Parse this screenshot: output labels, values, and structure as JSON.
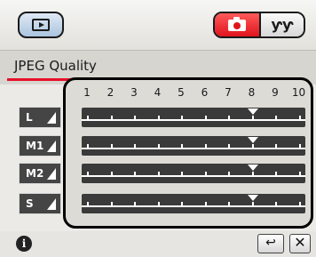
{
  "header": {
    "play_icon": "playback-icon",
    "camera_icon": "camera-icon",
    "setup_icon": "tools-icon",
    "setup_glyph": "ƴƴ"
  },
  "page": {
    "title": "JPEG Quality",
    "accent_color": "#e8102a"
  },
  "scale": {
    "labels": [
      "1",
      "2",
      "3",
      "4",
      "5",
      "6",
      "7",
      "8",
      "9",
      "10"
    ]
  },
  "rows": [
    {
      "label": "L",
      "selected": "8"
    },
    {
      "label": "M1",
      "selected": "8"
    },
    {
      "label": "M2",
      "selected": "8"
    },
    {
      "label": "S",
      "selected": "8"
    }
  ],
  "footer": {
    "info_glyph": "i",
    "back_glyph": "↩",
    "close_glyph": "✕"
  }
}
